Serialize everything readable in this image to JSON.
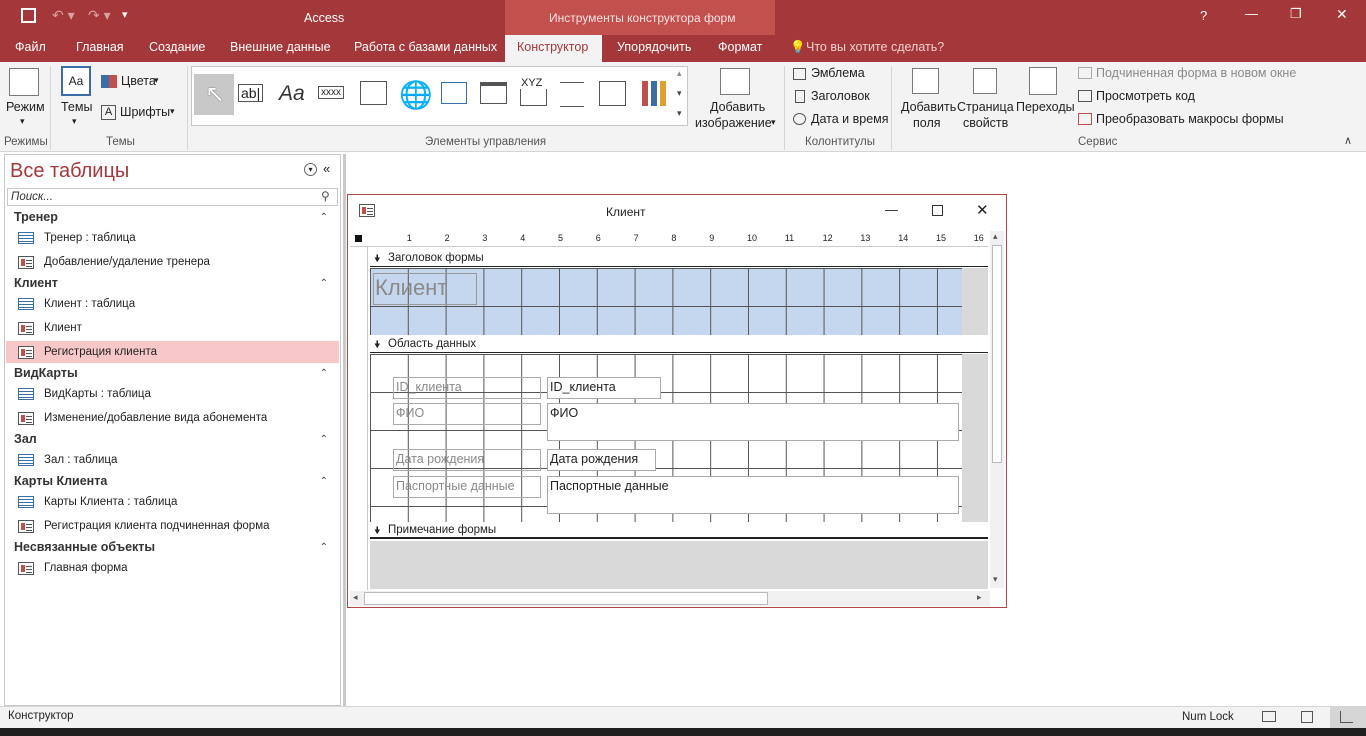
{
  "window": {
    "app_title": "Access",
    "context_title": "Инструменты конструктора форм",
    "help": "?",
    "min": "—",
    "restore": "❐",
    "close": "✕"
  },
  "tabs": [
    "Файл",
    "Главная",
    "Создание",
    "Внешние данные",
    "Работа с базами данных",
    "Конструктор",
    "Упорядочить",
    "Формат"
  ],
  "tell_me": "Что вы хотите сделать?",
  "ribbon": {
    "modes": {
      "view_label": "Режим",
      "group": "Режимы"
    },
    "themes": {
      "themes_label": "Темы",
      "colors": "Цвета",
      "fonts": "Шрифты",
      "group": "Темы"
    },
    "controls": {
      "group": "Элементы управления",
      "add_image_1": "Добавить",
      "add_image_2": "изображение",
      "label_abl": "ab|",
      "label_aa": "Aa",
      "label_xxxx": "xxxx",
      "label_xyz": "XYZ"
    },
    "header_footer": {
      "logo": "Эмблема",
      "title": "Заголовок",
      "datetime": "Дата и время",
      "group": "Колонтитулы"
    },
    "tools": {
      "add_fields_1": "Добавить",
      "add_fields_2": "поля",
      "prop_1": "Страница",
      "prop_2": "свойств",
      "tab_order": "Переходы",
      "subform": "Подчиненная форма в новом окне",
      "view_code": "Просмотреть код",
      "convert_macros": "Преобразовать макросы формы",
      "group": "Сервис"
    }
  },
  "nav": {
    "title": "Все таблицы",
    "search_placeholder": "Поиск...",
    "groups": [
      {
        "name": "Тренер",
        "items": [
          "Тренер : таблица",
          "Добавление/удаление тренера"
        ]
      },
      {
        "name": "Клиент",
        "items": [
          "Клиент : таблица",
          "Клиент",
          "Регистрация клиента"
        ]
      },
      {
        "name": "ВидКарты",
        "items": [
          "ВидКарты : таблица",
          "Изменение/добавление вида абонемента"
        ]
      },
      {
        "name": "Зал",
        "items": [
          "Зал : таблица"
        ]
      },
      {
        "name": "Карты Клиента",
        "items": [
          "Карты Клиента : таблица",
          "Регистрация клиента подчиненная форма"
        ]
      },
      {
        "name": "Несвязанные объекты",
        "items": [
          "Главная форма"
        ]
      }
    ]
  },
  "form": {
    "title": "Клиент",
    "ruler": [
      "1",
      "2",
      "3",
      "4",
      "5",
      "6",
      "7",
      "8",
      "9",
      "10",
      "11",
      "12",
      "13",
      "14",
      "15",
      "16"
    ],
    "sections": {
      "header": "Заголовок формы",
      "detail": "Область данных",
      "footer": "Примечание формы"
    },
    "header_label": "Клиент",
    "labels": [
      "ID_клиента",
      "ФИО",
      "Дата рождения",
      "Паспортные данные"
    ],
    "fields": [
      "ID_клиента",
      "ФИО",
      "Дата рождения",
      "Паспортные данные"
    ]
  },
  "status": {
    "mode": "Конструктор",
    "numlock": "Num Lock"
  }
}
